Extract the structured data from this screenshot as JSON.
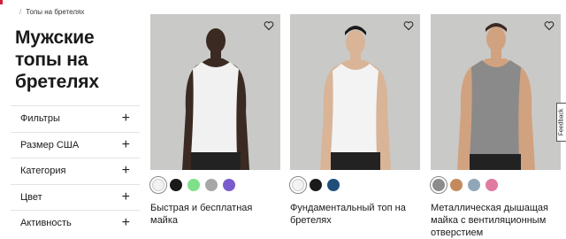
{
  "breadcrumb": {
    "current": "Топы на бретелях"
  },
  "page_title": "Мужские топы на бретелях",
  "filters": [
    {
      "label": "Фильтры"
    },
    {
      "label": "Размер США"
    },
    {
      "label": "Категория"
    },
    {
      "label": "Цвет"
    },
    {
      "label": "Активность"
    }
  ],
  "products": [
    {
      "name": "Быстрая и бесплатная майка",
      "swatches": [
        "#f2f2f2",
        "#1a1a1a",
        "#7fe08a",
        "#a7a7a7",
        "#7a5ccc"
      ],
      "selected_swatch": 0
    },
    {
      "name": "Фундаментальный топ на бретелях",
      "swatches": [
        "#f3f3f3",
        "#1a1a1a",
        "#1f4f7a"
      ],
      "selected_swatch": 0
    },
    {
      "name": "Металлическая дышащая майка с вентиляционным отверстием",
      "swatches": [
        "#8c8c8c",
        "#c58a5c",
        "#8fa7b8",
        "#e07aa0"
      ],
      "selected_swatch": 0
    }
  ],
  "feedback_label": "Feedback",
  "colors": {
    "brand_red": "#d31f37",
    "image_bg": "#c9c9c7"
  }
}
